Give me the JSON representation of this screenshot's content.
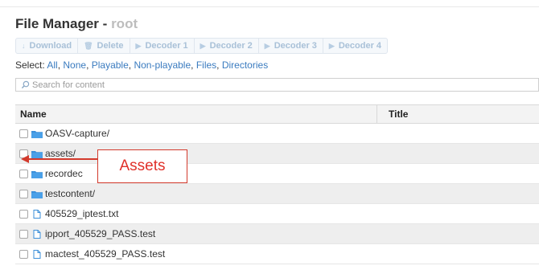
{
  "header": {
    "title": "File Manager",
    "separator": "-",
    "location": "root"
  },
  "toolbar": {
    "buttons": [
      {
        "label": "Download",
        "icon": "download-icon"
      },
      {
        "label": "Delete",
        "icon": "trash-icon"
      },
      {
        "label": "Decoder 1",
        "icon": "play-icon"
      },
      {
        "label": "Decoder 2",
        "icon": "play-icon"
      },
      {
        "label": "Decoder 3",
        "icon": "play-icon"
      },
      {
        "label": "Decoder 4",
        "icon": "play-icon"
      }
    ]
  },
  "select": {
    "prefix": "Select:",
    "options": [
      "All",
      "None",
      "Playable",
      "Non-playable",
      "Files",
      "Directories"
    ]
  },
  "search": {
    "placeholder": "Search for content"
  },
  "table": {
    "columns": [
      "Name",
      "Title"
    ],
    "rows": [
      {
        "name": "OASV-capture/",
        "type": "folder"
      },
      {
        "name": "assets/",
        "type": "folder"
      },
      {
        "name": "recordec",
        "type": "folder"
      },
      {
        "name": "testcontent/",
        "type": "folder"
      },
      {
        "name": "405529_iptest.txt",
        "type": "file"
      },
      {
        "name": "ipport_405529_PASS.test",
        "type": "file"
      },
      {
        "name": "mactest_405529_PASS.test",
        "type": "file"
      }
    ]
  },
  "annotation": {
    "label": "Assets",
    "color": "#e0312a"
  },
  "colors": {
    "link": "#3a7bbf",
    "folder": "#3b8fd9",
    "disabled_button_text": "#a9c1d8"
  }
}
